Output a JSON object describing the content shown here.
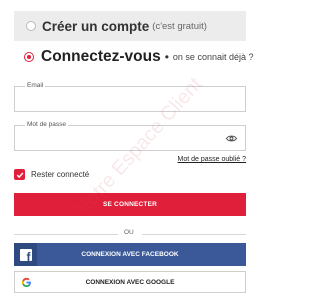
{
  "create_account": {
    "title": "Créer un compte",
    "subtitle": "(c'est gratuit)"
  },
  "login": {
    "title": "Connectez-vous",
    "separator": "•",
    "subtitle": "on se connait déjà ?"
  },
  "email_field": {
    "label": "Email",
    "value": ""
  },
  "password_field": {
    "label": "Mot de passe",
    "value": ""
  },
  "forgot_password": "Mot de passe oublié ?",
  "remember_me": {
    "label": "Rester connecté",
    "checked": true
  },
  "submit_button": "SE CONNECTER",
  "separator": "OU",
  "facebook_button": "CONNEXION AVEC FACEBOOK",
  "google_button": "CONNEXION AVEC GOOGLE",
  "watermark": "Votre Espace Client",
  "colors": {
    "accent": "#e0203a",
    "facebook": "#3b5998",
    "tab_background": "#ececec"
  },
  "icons": {
    "password_toggle": "eye-icon",
    "facebook": "facebook-icon",
    "google": "google-icon",
    "remember": "checkmark-icon"
  }
}
